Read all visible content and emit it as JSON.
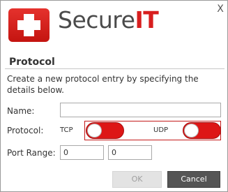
{
  "window": {
    "close_label": "X"
  },
  "logo": {
    "brand_part1": "Secure",
    "brand_part2": "IT"
  },
  "section": {
    "title": "Protocol",
    "description": "Create a new protocol entry by specifying the details below."
  },
  "form": {
    "name_label": "Name:",
    "name_value": "",
    "protocol_label": "Protocol:",
    "tcp_label": "TCP",
    "udp_label": "UDP",
    "tcp_enabled": false,
    "udp_enabled": false,
    "port_range_label": "Port Range:",
    "port_from": "0",
    "port_to": "0"
  },
  "buttons": {
    "ok_label": "OK",
    "cancel_label": "Cancel",
    "ok_enabled": false
  },
  "colors": {
    "accent": "#d81e1e",
    "toggle_track": "#dd1616",
    "cancel_bg": "#555555",
    "ok_disabled_bg": "#e3e3e3"
  },
  "icons": {
    "logo_icon": "red-cross-icon",
    "close_icon": "x-icon"
  }
}
